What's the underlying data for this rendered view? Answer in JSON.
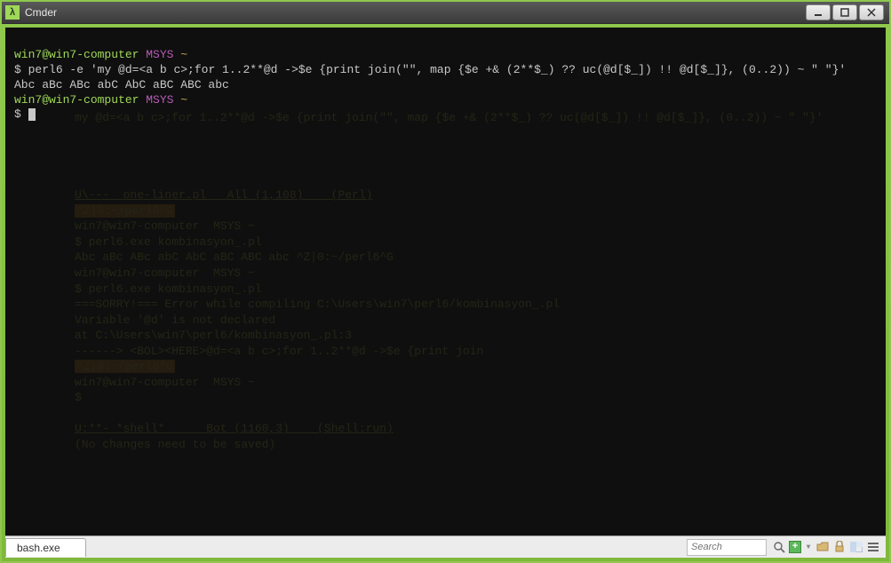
{
  "window": {
    "title": "Cmder",
    "icon_glyph": "λ"
  },
  "terminal": {
    "prompt1_user": "win7@win7-computer",
    "prompt1_sys": "MSYS",
    "prompt1_path": "~",
    "prompt1_symbol": "$",
    "command": "perl6 -e 'my @d=<a b c>;for 1..2**@d ->$e {print join(\"\", map {$e +& (2**$_) ?? uc(@d[$_]) !! @d[$_]}, (0..2)) ~ \" \"}'",
    "output": "Abc aBc ABc abC AbC aBC ABC abc",
    "prompt2_user": "win7@win7-computer",
    "prompt2_sys": "MSYS",
    "prompt2_path": "~",
    "prompt2_symbol": "$"
  },
  "ghost": {
    "line_cmd_echo": "my @d=<a b c>;for 1..2**@d ->$e {print join(\"\", map {$e +& (2**$_) ?? uc(@d[$_]) !! @d[$_]}, (0..2)) ~ \" \"}'",
    "status1": "U\\---  one-liner.pl   All (1,108)    (Perl)",
    "shellbadge1": "^Z|0:~/perl6^G",
    "ghostprompt1": "win7@win7-computer  MSYS ~",
    "cmd1": "$ perl6.exe kombinasyon_.pl",
    "out1": "Abc aBc ABc abC AbC aBC ABC abc ^Z|0:~/perl6^G",
    "ghostprompt2": "win7@win7-computer  MSYS ~",
    "cmd2": "$ perl6.exe kombinasyon_.pl",
    "err1": "===SORRY!=== Error while compiling C:\\Users\\win7\\perl6/kombinasyon_.pl",
    "err2": "Variable '@d' is not declared",
    "err3": "at C:\\Users\\win7\\perl6/kombinasyon_.pl:3",
    "err4": "------> <BOL><HERE>@d=<a b c>;for 1..2**@d ->$e {print join",
    "shellbadge2": "^Z|0:~/perl6^G",
    "ghostprompt3": "win7@win7-computer  MSYS ~",
    "prompt3": "$ ",
    "status2": "U:**- *shell*      Bot (1160,3)    (Shell:run)",
    "bottom": "(No changes need to be saved)"
  },
  "statusbar": {
    "tab_label": "bash.exe",
    "search_placeholder": "Search"
  }
}
